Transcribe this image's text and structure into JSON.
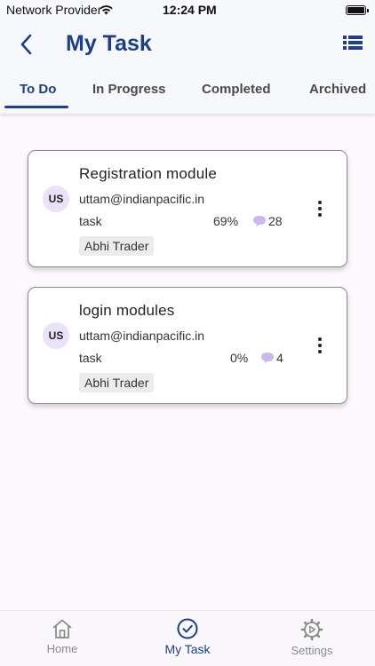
{
  "status_bar": {
    "carrier": "Network Provider",
    "time": "12:24 PM"
  },
  "header": {
    "title": "My Task"
  },
  "tabs": [
    {
      "label": "To Do",
      "active": true
    },
    {
      "label": "In Progress",
      "active": false
    },
    {
      "label": "Completed",
      "active": false
    },
    {
      "label": "Archived",
      "active": false
    }
  ],
  "tasks": [
    {
      "name": "Registration module",
      "avatar": "US",
      "email": "uttam@indianpacific.in",
      "type": "task",
      "progress": "69%",
      "comments": "28",
      "tag": "Abhi Trader"
    },
    {
      "name": "login modules",
      "avatar": "US",
      "email": "uttam@indianpacific.in",
      "type": "task",
      "progress": "0%",
      "comments": "4",
      "tag": "Abhi Trader"
    }
  ],
  "bottom_nav": [
    {
      "label": "Home",
      "icon": "home-icon",
      "active": false
    },
    {
      "label": "My Task",
      "icon": "check-circle-icon",
      "active": true
    },
    {
      "label": "Settings",
      "icon": "gear-icon",
      "active": false
    }
  ],
  "colors": {
    "accent": "#1d3f87",
    "avatar_bg": "#ebe1f9",
    "comment_icon": "#c9b7ee"
  }
}
